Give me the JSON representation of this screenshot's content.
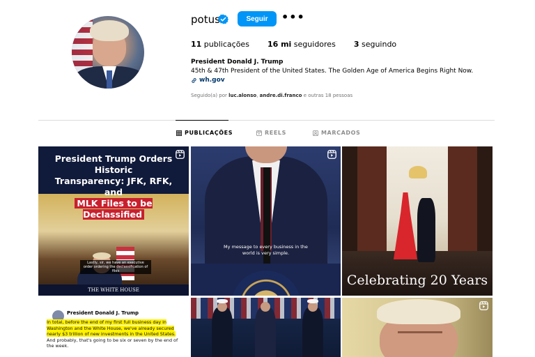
{
  "profile": {
    "username": "potus",
    "follow_label": "Seguir",
    "more_label": "•••",
    "stats": [
      {
        "value": "11",
        "label": " publicações"
      },
      {
        "value": "16 mi",
        "label": " seguidores"
      },
      {
        "value": "3",
        "label": " seguindo"
      }
    ],
    "full_name": "President Donald J. Trump",
    "bio": "45th & 47th President of the United States. The Golden Age of America Begins Right Now.",
    "link": "wh.gov",
    "followed_by_prefix": "Seguido(a) por ",
    "followed_by_users": [
      "luc.alonso",
      "andre.di.franco"
    ],
    "followed_by_suffix": " e outras 18 pessoas"
  },
  "tabs": [
    {
      "label": "PUBLICAÇÕES",
      "icon": "grid-icon",
      "active": true
    },
    {
      "label": "REELS",
      "icon": "reels-icon",
      "active": false
    },
    {
      "label": "MARCADOS",
      "icon": "tagged-icon",
      "active": false
    }
  ],
  "posts": {
    "p1": {
      "headline_line1": "President Trump Orders Historic",
      "headline_line2": "Transparency: JFK, RFK, and",
      "headline_line3": "MLK Files to be Declassified",
      "caption": "Lastly, sir, we have an executive order ordering the declassification of files",
      "footer": "THE WHITE HOUSE"
    },
    "p2": {
      "subtitle": "My message to every business in the world is very simple."
    },
    "p3": {
      "title": "Celebrating 20 Years"
    },
    "p4": {
      "name": "President Donald J. Trump",
      "text_pre": "In total, before the end of my first full business day in Washington and the White House, we've already secured nearly $3 trillion of new investments in the United States.",
      "text_post": " And probably, that's going to be six or seven by the end of the week."
    }
  },
  "colors": {
    "follow_button": "#0095f6",
    "verified_badge": "#0095f6",
    "link": "#00376b",
    "highlight_red": "#c8202e",
    "highlight_yellow": "#fff200"
  }
}
